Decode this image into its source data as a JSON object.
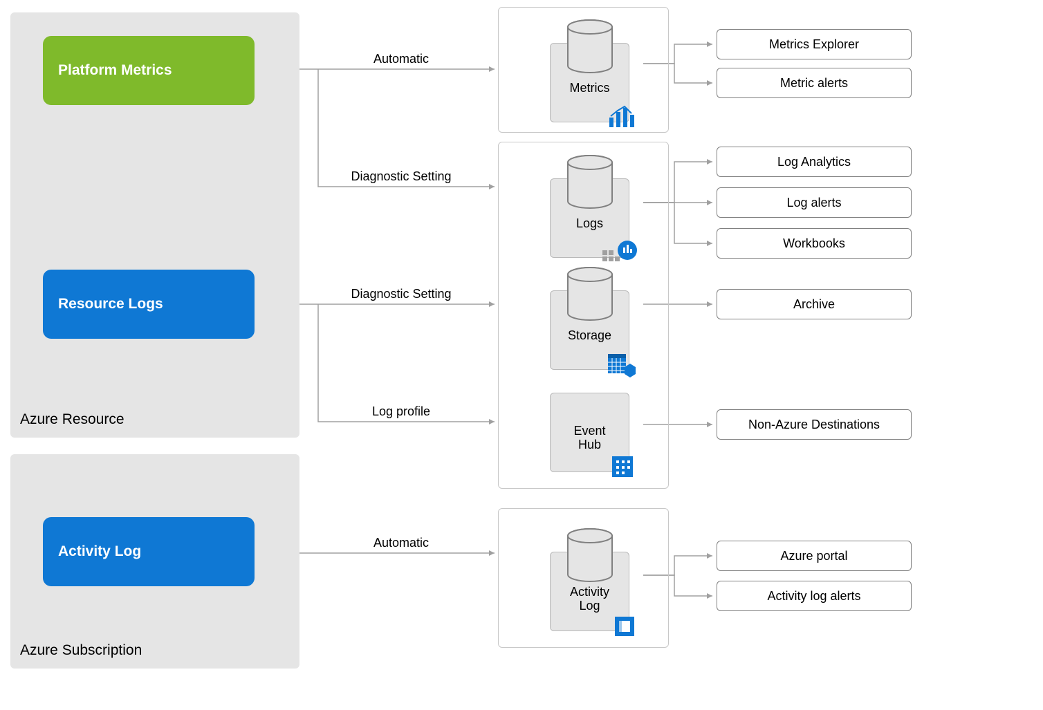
{
  "regions": {
    "resource_label": "Azure Resource",
    "subscription_label": "Azure Subscription"
  },
  "sources": {
    "platform_metrics": "Platform Metrics",
    "resource_logs": "Resource Logs",
    "activity_log": "Activity Log"
  },
  "edges": {
    "automatic": "Automatic",
    "diagnostic_setting": "Diagnostic Setting",
    "log_profile": "Log profile"
  },
  "destinations": {
    "metrics": "Metrics",
    "logs": "Logs",
    "storage": "Storage",
    "event_hub": "Event\nHub",
    "activity_log": "Activity\nLog"
  },
  "consumers": {
    "metrics_explorer": "Metrics Explorer",
    "metric_alerts": "Metric alerts",
    "log_analytics": "Log Analytics",
    "log_alerts": "Log alerts",
    "workbooks": "Workbooks",
    "archive": "Archive",
    "non_azure": "Non-Azure Destinations",
    "azure_portal": "Azure portal",
    "activity_log_alerts": "Activity log alerts"
  },
  "colors": {
    "arrow": "#a0a0a0",
    "azure_blue": "#0f78d4"
  }
}
